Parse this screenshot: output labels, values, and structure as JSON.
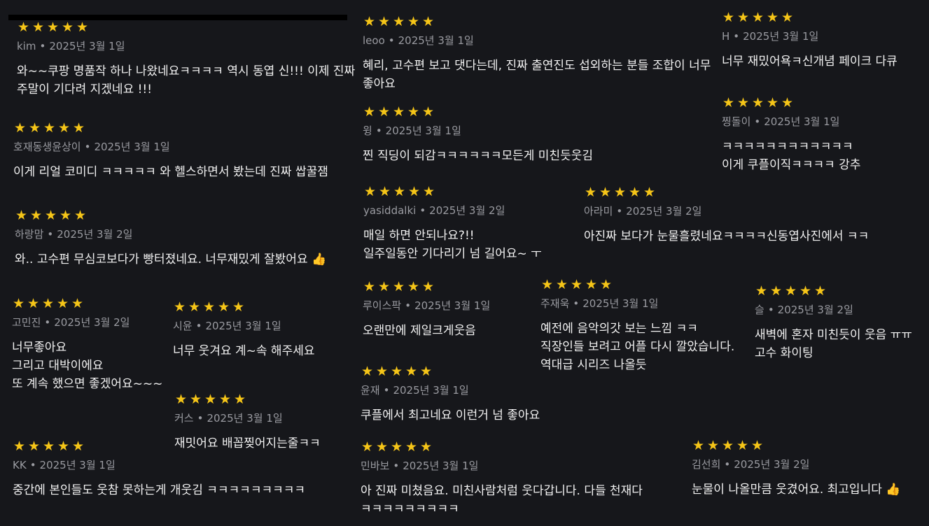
{
  "reviews": [
    {
      "rating": 5,
      "user": "kim",
      "date": "2025년 3월 1일",
      "text": "와~~쿠팡 명품작 하나 나왔네요ㅋㅋㅋㅋ 역시 동엽 신!!! 이제 진짜\n주말이 기다려 지겠네요 !!!"
    },
    {
      "rating": 5,
      "user": "호재동생윤상이",
      "date": "2025년 3월 1일",
      "text": "이게 리얼 코미디 ㅋㅋㅋㅋㅋ 와 헬스하면서 봤는데 진짜 쌉꿀잼"
    },
    {
      "rating": 5,
      "user": "하랑맘",
      "date": "2025년 3월 2일",
      "text": "와.. 고수편 무심코보다가 빵터졌네요. 너무재밌게 잘봤어요 👍"
    },
    {
      "rating": 5,
      "user": "고민진",
      "date": "2025년 3월 2일",
      "text": "너무좋아요\n그리고 대박이에요\n또 계속 했으면 좋겠어요~~~"
    },
    {
      "rating": 5,
      "user": "시윤",
      "date": "2025년 3월 1일",
      "text": "너무 웃겨요 계~속 해주세요"
    },
    {
      "rating": 5,
      "user": "커스",
      "date": "2025년 3월 1일",
      "text": "재밋어요 배꼽찢어지는줄ㅋㅋ"
    },
    {
      "rating": 5,
      "user": "KK",
      "date": "2025년 3월 1일",
      "text": "중간에 본인들도 웃참 못하는게 개웃김 ㅋㅋㅋㅋㅋㅋㅋㅋㅋ"
    },
    {
      "rating": 5,
      "user": "leoo",
      "date": "2025년 3월 1일",
      "text": "혜리, 고수편 보고 댓다는데, 진짜 출연진도 섭외하는 분들 조합이 너무\n좋아요"
    },
    {
      "rating": 5,
      "user": "윙",
      "date": "2025년 3월 1일",
      "text": "찐 직딩이 되감ㅋㅋㅋㅋㅋㅋ모든게 미친듯웃김"
    },
    {
      "rating": 5,
      "user": "yasiddalki",
      "date": "2025년 3월 2일",
      "text": "매일 하면 안되나요?!!\n일주일동안 기다리기 넘 길어요~ ㅜ"
    },
    {
      "rating": 5,
      "user": "아라미",
      "date": "2025년 3월 2일",
      "text": "아진짜 보다가 눈물흘렸네요ㅋㅋㅋㅋ신동엽사진에서 ㅋㅋ"
    },
    {
      "rating": 5,
      "user": "루이스팍",
      "date": "2025년 3월 1일",
      "text": "오랜만에 제일크게웃음"
    },
    {
      "rating": 5,
      "user": "주재욱",
      "date": "2025년 3월 1일",
      "text": "예전에 음악의갓 보는 느낌 ㅋㅋ\n직장인들 보려고 어플 다시 깔았습니다.\n역대급 시리즈 나올듯"
    },
    {
      "rating": 5,
      "user": "윤재",
      "date": "2025년 3월 1일",
      "text": "쿠플에서 최고네요 이런거 넘 좋아요"
    },
    {
      "rating": 5,
      "user": "민바보",
      "date": "2025년 3월 1일",
      "text": "아 진짜 미쳤음요. 미친사람처럼 웃다갑니다. 다들 천재다\nㅋㅋㅋㅋㅋㅋㅋㅋㅋ"
    },
    {
      "rating": 5,
      "user": "H",
      "date": "2025년 3월 1일",
      "text": "너무 재밌어욕ㅋ신개념 페이크 다큐"
    },
    {
      "rating": 5,
      "user": "찡돌이",
      "date": "2025년 3월 1일",
      "text": "ㅋㅋㅋㅋㅋㅋㅋㅋㅋㅋㅋㅋ\n이게 쿠플이직ㅋㅋㅋㅋ 강추"
    },
    {
      "rating": 5,
      "user": "슬",
      "date": "2025년 3월 2일",
      "text": "새벽에 혼자 미친듯이 웃음 ㅠㅠ\n고수 화이팅"
    },
    {
      "rating": 5,
      "user": "김선희",
      "date": "2025년 3월 2일",
      "text": "눈물이 나올만큼 웃겼어요. 최고입니다 👍"
    }
  ],
  "colors": {
    "background": "#16171b",
    "star": "#f5c518",
    "meta": "#9a9ba1",
    "text": "#f2f2f2"
  },
  "icons": {
    "star": "star-icon",
    "separator": "•"
  }
}
